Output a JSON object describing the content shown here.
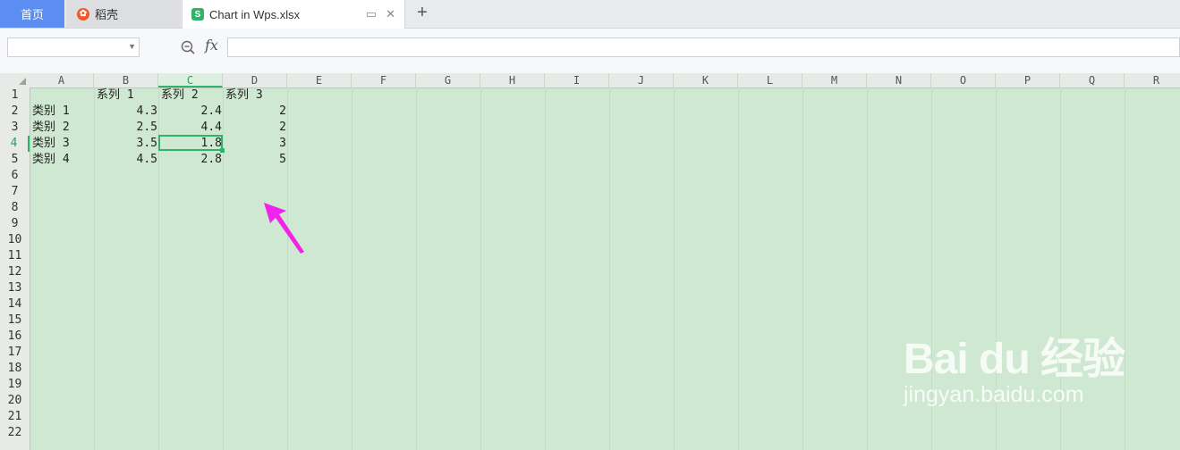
{
  "tabs": {
    "home": "首页",
    "daoke": "稻壳",
    "file": "Chart in Wps.xlsx"
  },
  "formula": {
    "namebox_value": "",
    "fx_label": "fx",
    "content": ""
  },
  "columns": [
    "A",
    "B",
    "C",
    "D",
    "E",
    "F",
    "G",
    "H",
    "I",
    "J",
    "K",
    "L",
    "M",
    "N",
    "O",
    "P",
    "Q",
    "R"
  ],
  "selected_column": "C",
  "rows": [
    "1",
    "2",
    "3",
    "4",
    "5",
    "6",
    "7",
    "8",
    "9",
    "10",
    "11",
    "12",
    "13",
    "14",
    "15",
    "16",
    "17",
    "18",
    "19",
    "20",
    "21",
    "22"
  ],
  "selected_row": "4",
  "cells": {
    "B1": "系列 1",
    "C1": "系列 2",
    "D1": "系列 3",
    "A2": "类别 1",
    "B2": "4.3",
    "C2": "2.4",
    "D2": "2",
    "A3": "类别 2",
    "B3": "2.5",
    "C3": "4.4",
    "D3": "2",
    "A4": "类别 3",
    "B4": "3.5",
    "C4": "1.8",
    "D4": "3",
    "A5": "类别 4",
    "B5": "4.5",
    "C5": "2.8",
    "D5": "5"
  },
  "watermark": {
    "logo": "Bai du 经验",
    "url": "jingyan.baidu.com"
  },
  "colors": {
    "grid_bg": "#cfe8d1",
    "selection": "#2fb36b",
    "arrow": "#f024e8"
  }
}
